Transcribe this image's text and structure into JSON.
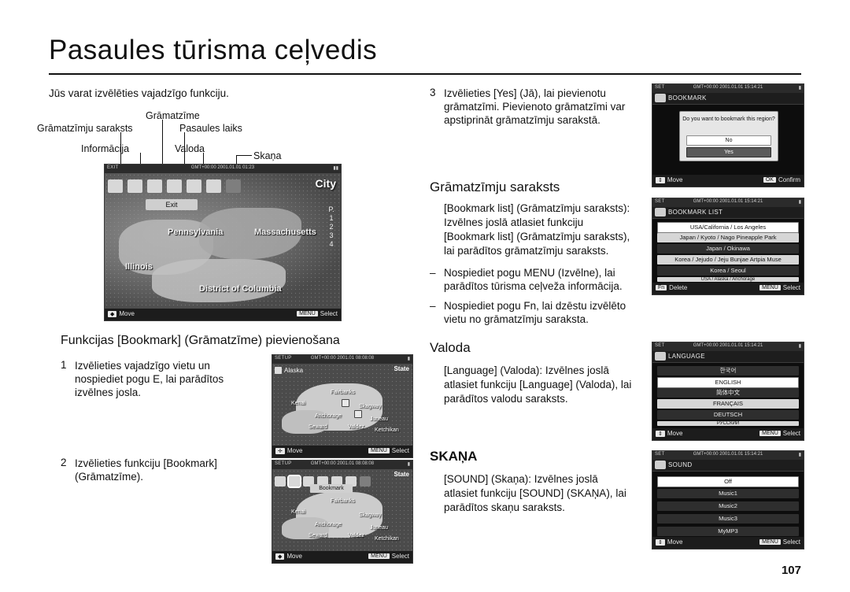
{
  "page": {
    "title": "Pasaules tūrisma ceļvedis",
    "number": "107"
  },
  "left_column": {
    "intro": "Jūs varat izvēlēties vajadzīgo funkciju.",
    "callouts": {
      "bookmark": "Grāmatzīme",
      "bookmark_list": "Grāmatzīmju saraksts",
      "world_time": "Pasaules laiks",
      "information": "Informācija",
      "language": "Valoda",
      "sound": "Skaņa"
    },
    "section_heading": "Funkcijas [Bookmark] (Grāmatzīme) pievienošana",
    "steps": [
      {
        "num": "1",
        "text": "Izvēlieties vajadzīgo vietu un nospiediet pogu E, lai parādītos izvēlnes josla."
      },
      {
        "num": "2",
        "text": "Izvēlieties funkciju [Bookmark] (Grāmatzīme)."
      }
    ]
  },
  "right_column": {
    "step3": {
      "num": "3",
      "text": "Izvēlieties [Yes] (Jā), lai pievienotu grāmatzīmi. Pievienoto grāmatzīmi var apstiprināt grāmatzīmju sarakstā."
    },
    "sections": [
      {
        "heading": "Grāmatzīmju saraksts",
        "lines": [
          "[Bookmark list] (Grāmatzīmju saraksts):",
          "Izvēlnes joslā atlasiet funkciju",
          "[Bookmark list] (Grāmatzīmju saraksts),",
          "lai parādītos grāmatzīmju saraksts."
        ],
        "bullets": [
          "Nospiediet pogu MENU (Izvēlne), lai parādītos tūrisma ceļveža informācija.",
          "Nospiediet pogu Fn, lai dzēstu izvēlēto vietu no grāmatzīmju saraksta."
        ]
      },
      {
        "heading": "Valoda",
        "lines": [
          "[Language] (Valoda): Izvēlnes joslā",
          "atlasiet funkciju [Language] (Valoda), lai",
          "parādītos valodu saraksts."
        ]
      },
      {
        "heading": "SKAŅA",
        "lines": [
          "[SOUND] (Skaņa): Izvēlnes joslā",
          "atlasiet funkciju [SOUND] (SKAŅA), lai",
          "parādītos skaņu saraksts."
        ]
      }
    ]
  },
  "screens": {
    "map": {
      "status_left": "EXIT",
      "status_center": "GMT+00:00 2001.01.01 01:23",
      "exit_label": "Exit",
      "city_tag": "City",
      "labels": [
        "Pennsylvania",
        "Massachusetts",
        "Illinois",
        "District of Columbia"
      ],
      "zoom_marks": [
        "P.",
        "1",
        "2",
        "3",
        "4"
      ],
      "bottom_left": "Move",
      "bottom_key": "MENU",
      "bottom_right": "Select"
    },
    "alaska_step1": {
      "status_left": "SETUP",
      "status_center": "GMT+00:00 2001.01 08:08:08",
      "header": "Alaska",
      "state_tag": "State",
      "places": [
        "Fairbanks",
        "Anchorage",
        "Skagway",
        "Juneau",
        "Valdez",
        "Ketchikan",
        "Seward",
        "Kenai"
      ],
      "bottom_left": "Move",
      "bottom_key": "MENU",
      "bottom_right": "Select"
    },
    "alaska_step2": {
      "status_left": "SETUP",
      "status_center": "GMT+00:00 2001.01 08:08:08",
      "menu_caption": "Bookmark",
      "state_tag": "State",
      "places": [
        "Fairbanks",
        "Anchorage",
        "Skagway",
        "Juneau",
        "Valdez",
        "Ketchikan",
        "Seward",
        "Kenai"
      ],
      "bottom_left": "Move",
      "bottom_key": "MENU",
      "bottom_right": "Select"
    },
    "bookmark_confirm": {
      "status_left": "SET",
      "status_center": "GMT+00:00 2001.01.01 15:14:21",
      "title": "BOOKMARK",
      "dialog_text": "Do you want to bookmark this region?",
      "btn_no": "No",
      "btn_yes": "Yes",
      "bottom_left": "Move",
      "bottom_key": "OK",
      "bottom_right": "Confirm"
    },
    "bookmark_list": {
      "status_left": "SET",
      "status_center": "GMT+00:00 2001.01.01 15:14:21",
      "title": "BOOKMARK LIST",
      "rows": [
        "USA/California / Los Angeles",
        "Japan / Kyoto / Nago Pineapple Park",
        "Japan / Okinawa",
        "Korea / Jejudo / Jeju Bunjae Artpia Muse",
        "Korea / Seoul",
        "USA / Alaska / Anchorage"
      ],
      "bottom_fn": "Fn",
      "bottom_delete": "Delete",
      "bottom_key": "MENU",
      "bottom_right": "Select"
    },
    "language": {
      "status_left": "SET",
      "status_center": "GMT+00:00 2001.01.01 15:14:21",
      "title": "LANGUAGE",
      "rows": [
        "한국어",
        "ENGLISH",
        "简体中文",
        "FRANÇAIS",
        "DEUTSCH",
        "РУССКИЙ"
      ],
      "selected_index": 1,
      "bottom_left": "Move",
      "bottom_key": "MENU",
      "bottom_right": "Select"
    },
    "sound": {
      "status_left": "SET",
      "status_center": "GMT+00:00 2001.01.01 15:14:21",
      "title": "SOUND",
      "rows": [
        "Off",
        "Music1",
        "Music2",
        "Music3",
        "MyMP3"
      ],
      "selected_index": 0,
      "bottom_left": "Move",
      "bottom_key": "MENU",
      "bottom_right": "Select"
    }
  }
}
